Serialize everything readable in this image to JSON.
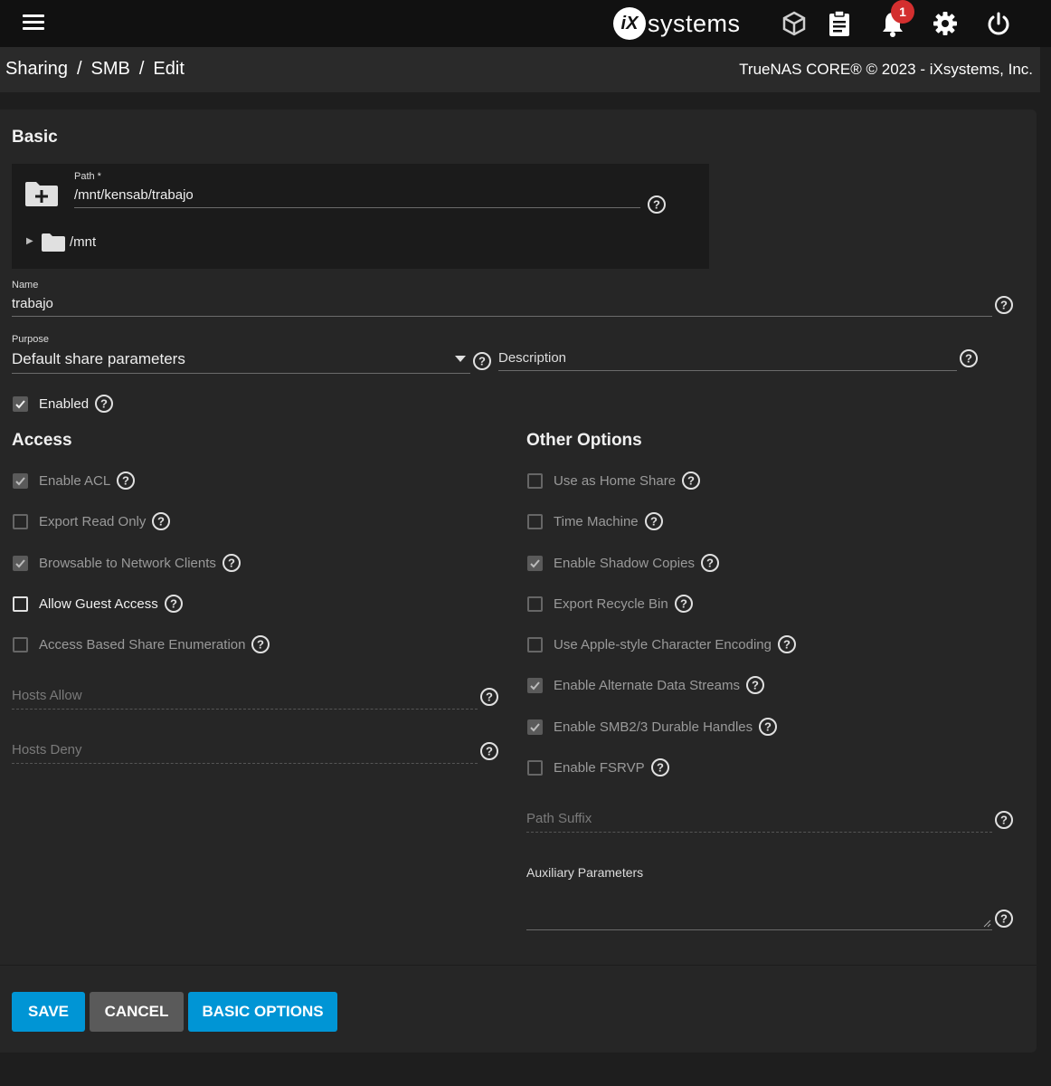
{
  "topbar": {
    "logo_mark": "iX",
    "logo_text": "systems",
    "notification_count": "1",
    "icons": [
      "menu-icon",
      "truecommand-icon",
      "clipboard-icon",
      "bell-icon",
      "gear-icon",
      "power-icon"
    ]
  },
  "breadcrumb": {
    "items": [
      "Sharing",
      "SMB",
      "Edit"
    ],
    "separator": "/",
    "copyright": "TrueNAS CORE® © 2023 - iXsystems, Inc."
  },
  "basic": {
    "title": "Basic",
    "path_label": "Path *",
    "path_value": "/mnt/kensab/trabajo",
    "tree_root": "/mnt",
    "name_label": "Name",
    "name_value": "trabajo",
    "purpose_label": "Purpose",
    "purpose_value": "Default share parameters",
    "description_placeholder": "Description",
    "enabled_label": "Enabled",
    "enabled_checked": true
  },
  "access": {
    "title": "Access",
    "options": [
      {
        "label": "Enable ACL",
        "checked": true,
        "disabled": true
      },
      {
        "label": "Export Read Only",
        "checked": false,
        "disabled": true
      },
      {
        "label": "Browsable to Network Clients",
        "checked": true,
        "disabled": true
      },
      {
        "label": "Allow Guest Access",
        "checked": false,
        "disabled": false
      },
      {
        "label": "Access Based Share Enumeration",
        "checked": false,
        "disabled": true
      }
    ],
    "hosts_allow_placeholder": "Hosts Allow",
    "hosts_deny_placeholder": "Hosts Deny"
  },
  "other": {
    "title": "Other Options",
    "options": [
      {
        "label": "Use as Home Share",
        "checked": false,
        "disabled": true
      },
      {
        "label": "Time Machine",
        "checked": false,
        "disabled": true
      },
      {
        "label": "Enable Shadow Copies",
        "checked": true,
        "disabled": true
      },
      {
        "label": "Export Recycle Bin",
        "checked": false,
        "disabled": true
      },
      {
        "label": "Use Apple-style Character Encoding",
        "checked": false,
        "disabled": true
      },
      {
        "label": "Enable Alternate Data Streams",
        "checked": true,
        "disabled": true
      },
      {
        "label": "Enable SMB2/3 Durable Handles",
        "checked": true,
        "disabled": true
      },
      {
        "label": "Enable FSRVP",
        "checked": false,
        "disabled": true
      }
    ],
    "path_suffix_placeholder": "Path Suffix",
    "aux_label": "Auxiliary Parameters"
  },
  "actions": {
    "save": "SAVE",
    "cancel": "CANCEL",
    "basic_options": "BASIC OPTIONS"
  },
  "colors": {
    "primary": "#0095d5",
    "secondary_button": "#5a5a5a",
    "badge": "#d32f2f",
    "background": "#1e1e1e",
    "card": "#262626"
  }
}
